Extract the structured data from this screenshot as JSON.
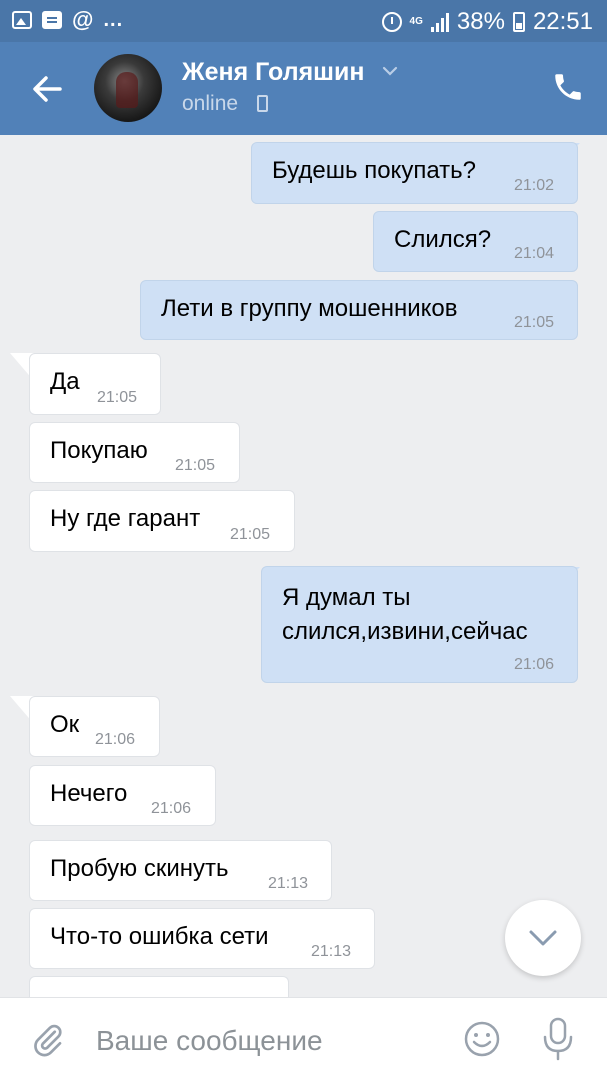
{
  "status_bar": {
    "battery": "38%",
    "time": "22:51",
    "network": "4G",
    "notifications": "...",
    "icons": [
      "gallery-icon",
      "message-icon",
      "at-icon",
      "alarm-icon",
      "signal-icon",
      "battery-icon"
    ]
  },
  "header": {
    "contact_name": "Женя Голяшин",
    "status": "online",
    "icons": [
      "back-arrow-icon",
      "chevron-down-icon",
      "mobile-icon",
      "phone-icon"
    ]
  },
  "messages": [
    {
      "dir": "out",
      "text": "Будешь покупать?",
      "time": "21:02"
    },
    {
      "dir": "out",
      "text": "Слился?",
      "time": "21:04"
    },
    {
      "dir": "out",
      "text": "Лети в группу мошенников",
      "time": "21:05"
    },
    {
      "dir": "in",
      "text": "Да",
      "time": "21:05"
    },
    {
      "dir": "in",
      "text": "Покупаю",
      "time": "21:05"
    },
    {
      "dir": "in",
      "text": "Ну где гарант",
      "time": "21:05"
    },
    {
      "dir": "out",
      "text": "Я думал ты\nслился,извини,сейчас",
      "time": "21:06"
    },
    {
      "dir": "in",
      "text": "Ок",
      "time": "21:06"
    },
    {
      "dir": "in",
      "text": "Нечего",
      "time": "21:06"
    },
    {
      "dir": "in",
      "text": "Пробую скинуть",
      "time": "21:13"
    },
    {
      "dir": "in",
      "text": "Что-то ошибка сети",
      "time": "21:13"
    }
  ],
  "composer": {
    "placeholder": "Ваше сообщение",
    "value": "",
    "icons": [
      "paperclip-icon",
      "emoji-icon",
      "microphone-icon",
      "scroll-down-icon"
    ]
  },
  "colors": {
    "header": "#5181b8",
    "status_bar": "#4a76a8",
    "chat_background": "#edeef0",
    "outgoing_bubble": "#cfe0f5",
    "incoming_bubble": "#ffffff"
  }
}
